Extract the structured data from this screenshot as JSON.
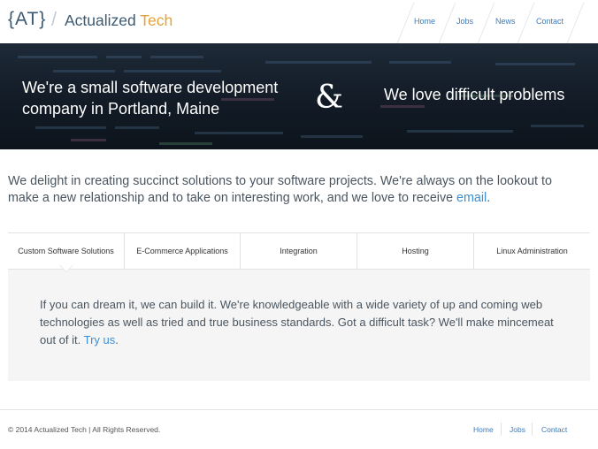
{
  "brand": {
    "mark": "{AT}",
    "slash": "/",
    "name_main": "Actualized",
    "name_accent": "Tech"
  },
  "nav": {
    "items": [
      "Home",
      "Jobs",
      "News",
      "Contact"
    ]
  },
  "hero": {
    "left_line1": "We're a small software development",
    "left_line2": "company in Portland, Maine",
    "ampersand": "&",
    "right": "We love difficult problems"
  },
  "intro": {
    "text": "We delight in creating succinct solutions to your software projects. We're always on the lookout to make a new relationship and to take on interesting work, and we love to receive ",
    "link": "email",
    "end": "."
  },
  "tabs": {
    "items": [
      "Custom Software Solutions",
      "E-Commerce Applications",
      "Integration",
      "Hosting",
      "Linux Administration"
    ],
    "active_index": 0
  },
  "panel": {
    "text": "If you can dream it, we can build it. We're knowledgeable with a wide variety of up and coming web technologies as well as tried and true business standards. Got a difficult task? We'll make mincemeat out of it. ",
    "link": "Try us",
    "end": "."
  },
  "footer": {
    "copyright": "© 2014 Actualized Tech | All Rights Reserved.",
    "links": [
      "Home",
      "Jobs",
      "Contact"
    ]
  },
  "colors": {
    "brand_blue": "#3c5a72",
    "accent_orange": "#e2a43a",
    "link_blue": "#3b8fd6"
  }
}
